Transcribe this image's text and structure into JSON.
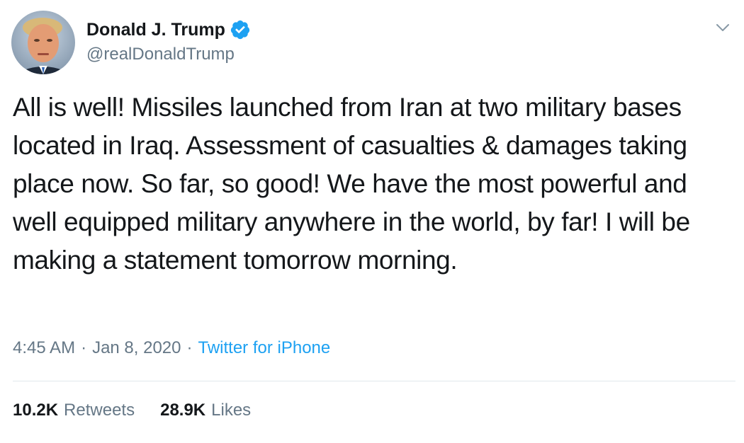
{
  "author": {
    "display_name": "Donald J. Trump",
    "handle": "@realDonaldTrump",
    "verified": true,
    "avatar_icon": "profile-photo",
    "verified_icon": "verified-badge-icon"
  },
  "menu": {
    "icon": "chevron-down-icon"
  },
  "tweet": {
    "text": "All is well! Missiles launched from Iran at two military bases located in Iraq. Assessment of casualties & damages taking place now. So far, so good! We have the most powerful and well equipped military anywhere in the world, by far! I will be making a statement tomorrow morning."
  },
  "meta": {
    "time": "4:45 AM",
    "separator": "·",
    "date": "Jan 8, 2020",
    "source": "Twitter for iPhone"
  },
  "stats": {
    "retweets_count": "10.2K",
    "retweets_label": "Retweets",
    "likes_count": "28.9K",
    "likes_label": "Likes"
  },
  "colors": {
    "text_primary": "#14171a",
    "text_secondary": "#657786",
    "accent": "#1da1f2",
    "divider": "#e1e8ed"
  }
}
